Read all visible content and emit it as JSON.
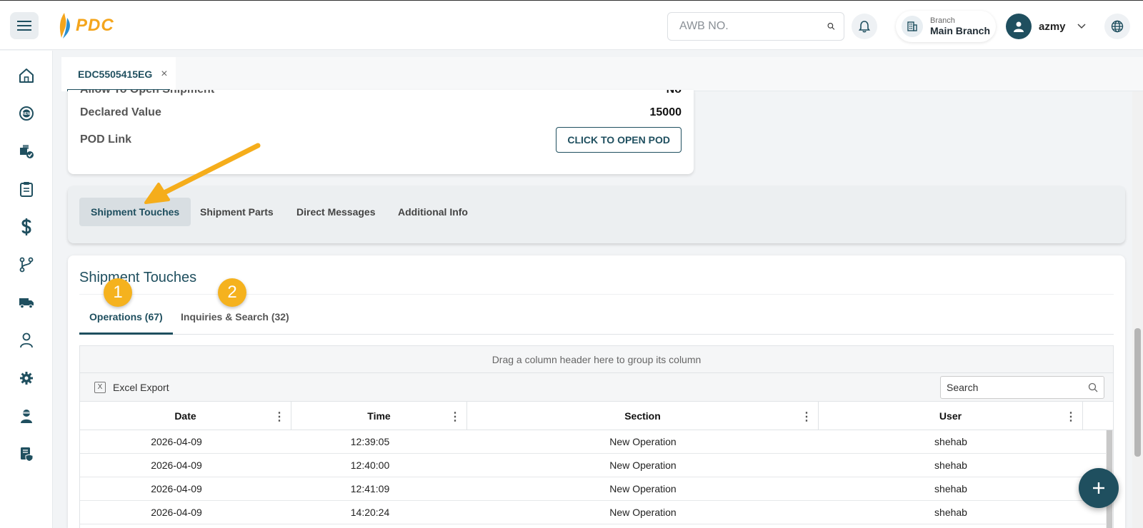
{
  "header": {
    "logo_text": "PDC",
    "awb_placeholder": "AWB NO.",
    "branch_caption": "Branch",
    "branch_name": "Main Branch",
    "username": "azmy"
  },
  "sidebar": {
    "items": [
      {
        "icon": "home-icon"
      },
      {
        "icon": "new-badge-icon"
      },
      {
        "icon": "packages-check-icon"
      },
      {
        "icon": "clipboard-icon"
      },
      {
        "icon": "dollar-icon"
      },
      {
        "icon": "branch-flow-icon"
      },
      {
        "icon": "truck-icon"
      },
      {
        "icon": "person-icon"
      },
      {
        "icon": "gear-icon"
      },
      {
        "icon": "courier-icon"
      },
      {
        "icon": "document-shield-icon"
      }
    ]
  },
  "open_tab": {
    "label": "EDC5505415EG",
    "close": "×"
  },
  "shipment_info": {
    "cut_off_label": "Allow To Open Shipment",
    "cut_off_value": "No",
    "declared_label": "Declared Value",
    "declared_value": "15000",
    "pod_label": "POD Link",
    "pod_button": "CLICK TO OPEN POD"
  },
  "section_tabs": [
    {
      "label": "Shipment Touches",
      "active": true
    },
    {
      "label": "Shipment Parts",
      "active": false
    },
    {
      "label": "Direct Messages",
      "active": false
    },
    {
      "label": "Additional Info",
      "active": false
    }
  ],
  "touches": {
    "title": "Shipment Touches",
    "subtabs": [
      {
        "label": "Operations (67)",
        "badge": "1"
      },
      {
        "label": "Inquiries & Search (32)",
        "badge": "2"
      }
    ],
    "group_hint": "Drag a column header here to group its column",
    "export_icon": "X",
    "export_label": "Excel Export",
    "search_placeholder": "Search",
    "columns": [
      "Date",
      "Time",
      "Section",
      "User"
    ],
    "rows": [
      [
        "2026-04-09",
        "12:39:05",
        "New Operation",
        "shehab"
      ],
      [
        "2026-04-09",
        "12:40:00",
        "New Operation",
        "shehab"
      ],
      [
        "2026-04-09",
        "12:41:09",
        "New Operation",
        "shehab"
      ],
      [
        "2026-04-09",
        "14:20:24",
        "New Operation",
        "shehab"
      ]
    ]
  },
  "colors": {
    "primary": "#1f4f5f",
    "accent": "#f5b21e",
    "logo": "#f4a51c"
  }
}
